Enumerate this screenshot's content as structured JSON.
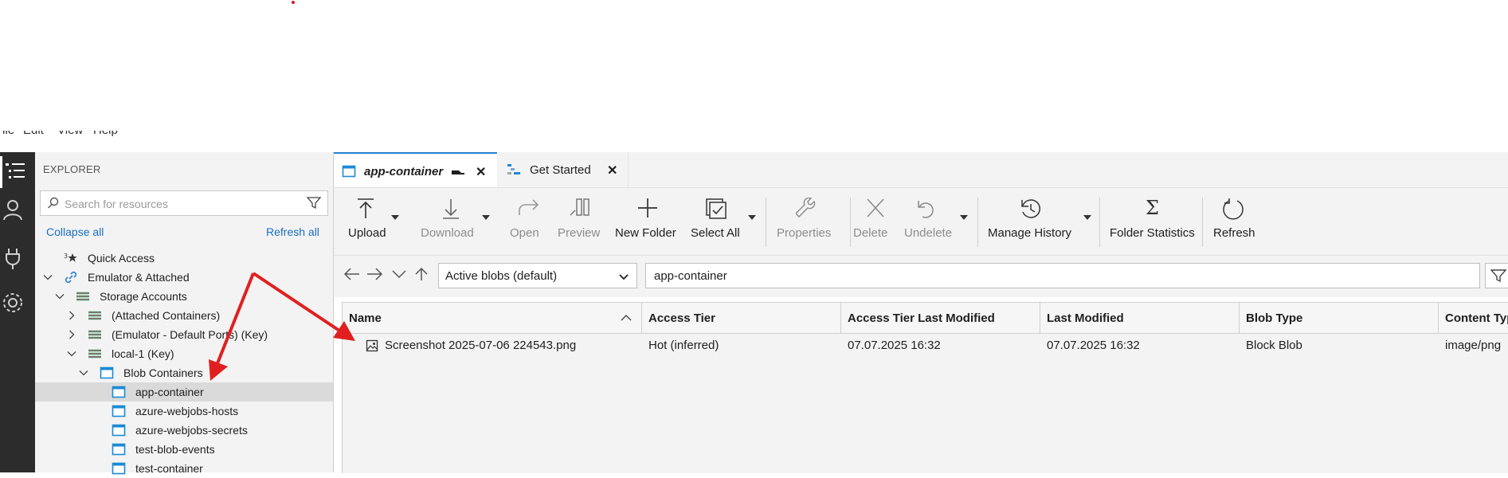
{
  "menubar": {
    "items": [
      "File",
      "Edit",
      "View",
      "Help"
    ]
  },
  "activity_bar": {
    "items": [
      "explorer-icon",
      "account-icon",
      "plug-icon",
      "settings-icon"
    ]
  },
  "explorer": {
    "title": "EXPLORER",
    "search_placeholder": "Search for resources",
    "collapse_all": "Collapse all",
    "refresh_all": "Refresh all",
    "tree": [
      {
        "label": "Quick Access",
        "icon": "quick-access-icon"
      },
      {
        "label": "Emulator & Attached",
        "icon": "link-icon",
        "expanded": true
      },
      {
        "label": "Storage Accounts",
        "icon": "storage-icon",
        "expanded": true
      },
      {
        "label": "(Attached Containers)",
        "icon": "storage-icon",
        "expanded": false
      },
      {
        "label": "(Emulator - Default Ports) (Key)",
        "icon": "storage-icon",
        "expanded": false
      },
      {
        "label": "local-1 (Key)",
        "icon": "storage-icon",
        "expanded": true
      },
      {
        "label": "Blob Containers",
        "icon": "container-icon",
        "expanded": true
      },
      {
        "label": "app-container",
        "icon": "container-icon",
        "selected": true
      },
      {
        "label": "azure-webjobs-hosts",
        "icon": "container-icon"
      },
      {
        "label": "azure-webjobs-secrets",
        "icon": "container-icon"
      },
      {
        "label": "test-blob-events",
        "icon": "container-icon"
      },
      {
        "label": "test-container",
        "icon": "container-icon"
      }
    ]
  },
  "tabs": [
    {
      "label": "app-container",
      "active": true
    },
    {
      "label": "Get Started",
      "active": false
    }
  ],
  "toolbar": {
    "buttons": [
      {
        "label": "Upload",
        "enabled": true
      },
      {
        "label": "Download",
        "enabled": false
      },
      {
        "label": "Open",
        "enabled": false
      },
      {
        "label": "Preview",
        "enabled": false
      },
      {
        "label": "New Folder",
        "enabled": true
      },
      {
        "label": "Select All",
        "enabled": true
      },
      {
        "label": "Properties",
        "enabled": false
      },
      {
        "label": "Delete",
        "enabled": false
      },
      {
        "label": "Undelete",
        "enabled": false
      },
      {
        "label": "Manage History",
        "enabled": true
      },
      {
        "label": "Folder Statistics",
        "enabled": true
      },
      {
        "label": "Refresh",
        "enabled": true
      }
    ]
  },
  "address": {
    "view_filter": "Active blobs (default)",
    "path": "app-container"
  },
  "table": {
    "columns": [
      "Name",
      "Access Tier",
      "Access Tier Last Modified",
      "Last Modified",
      "Blob Type",
      "Content Typ"
    ],
    "rows": [
      [
        "Screenshot 2025-07-06 224543.png",
        "Hot (inferred)",
        "07.07.2025 16:32",
        "07.07.2025 16:32",
        "Block Blob",
        "image/png"
      ]
    ]
  },
  "colors": {
    "accent": "#2b7fd4",
    "annotation": "#e02020",
    "container_icon": "#1b8ad6"
  }
}
